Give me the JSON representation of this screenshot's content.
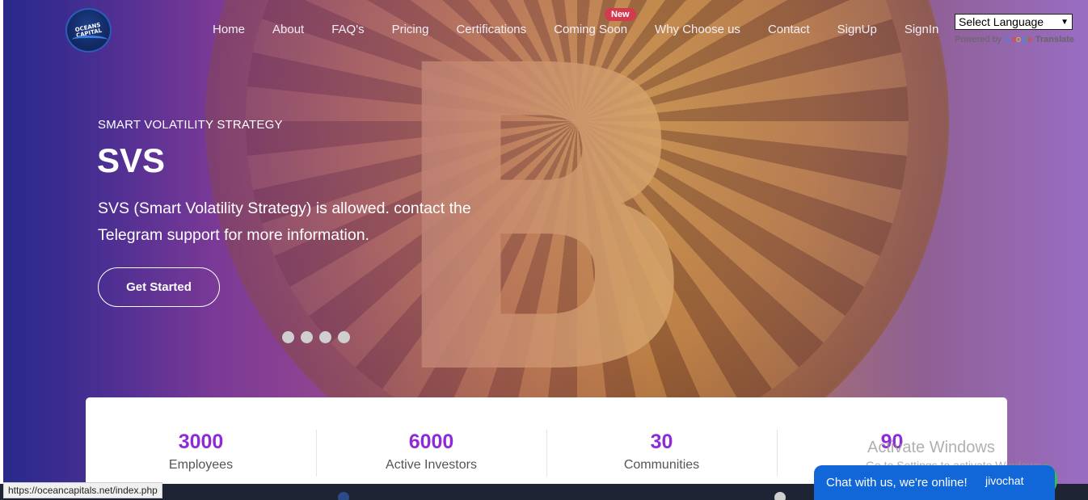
{
  "header": {
    "logo_text": "OCEANS CAPITAL",
    "nav": [
      "Home",
      "About",
      "FAQ's",
      "Pricing",
      "Certifications",
      "Coming Soon",
      "Why Choose us",
      "Contact",
      "SignUp",
      "SignIn"
    ],
    "new_badge": "New",
    "language_select": "Select Language",
    "powered_by": "Powered by",
    "google": [
      "G",
      "o",
      "o",
      "g",
      "l",
      "e"
    ],
    "translate": "Translate"
  },
  "hero": {
    "subtitle": "SMART VOLATILITY STRATEGY",
    "title": "SVS",
    "description": "SVS (Smart Volatility Strategy) is allowed. contact the Telegram support for more information.",
    "cta": "Get Started",
    "slide_count": 4,
    "symbol": "B"
  },
  "stats": [
    {
      "value": "3000",
      "label": "Employees"
    },
    {
      "value": "6000",
      "label": "Active Investors"
    },
    {
      "value": "30",
      "label": "Communities"
    },
    {
      "value": "90",
      "label": ""
    }
  ],
  "status_url": "https://oceancapitals.net/index.php",
  "watermark": {
    "line1": "Activate Windows",
    "line2": "Go to Settings to activate Windows."
  },
  "chat": {
    "text": "Chat with us, we're online!",
    "brand": "jivochat"
  },
  "colors": {
    "accent": "#8e2bd6",
    "chat": "#1167d8",
    "badge": "#d33a4e"
  }
}
